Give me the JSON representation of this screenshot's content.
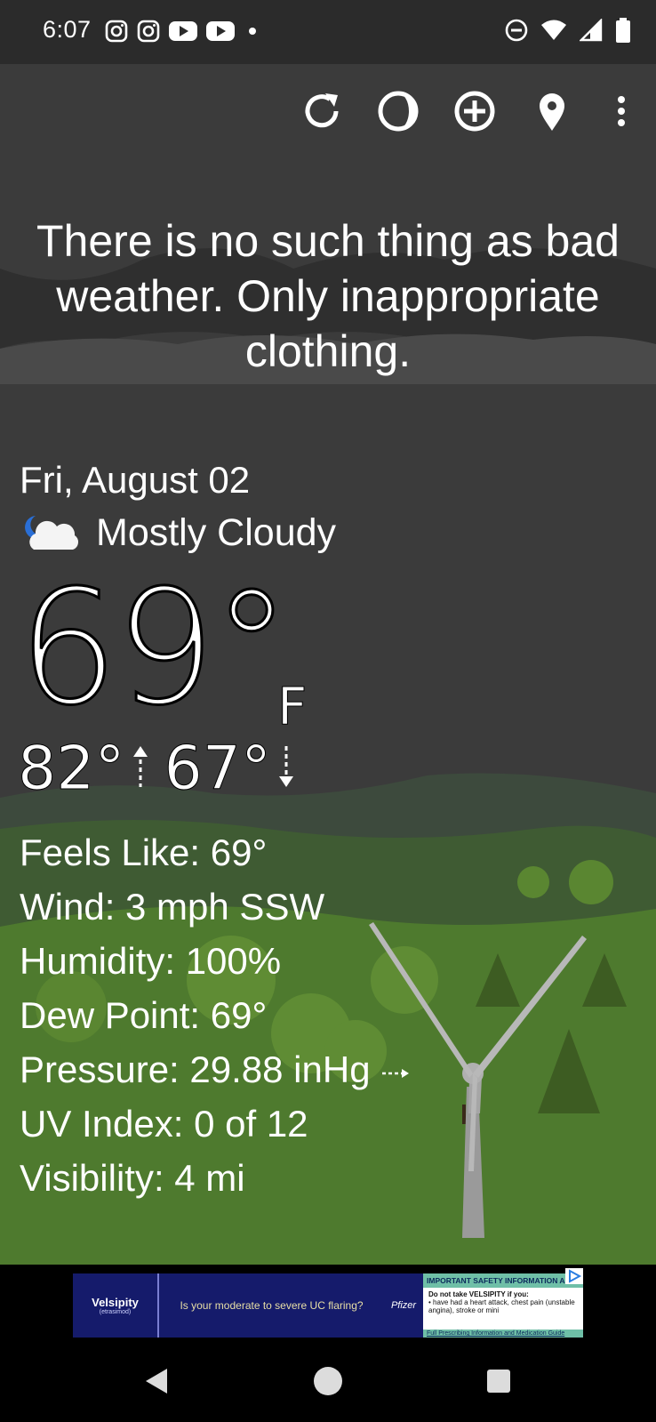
{
  "status_bar": {
    "time": "6:07",
    "left_icons": [
      "instagram-icon",
      "instagram-icon",
      "youtube-icon",
      "youtube-icon",
      "dot-icon"
    ],
    "right_icons": [
      "do-not-disturb-icon",
      "wifi-icon",
      "signal-icon",
      "battery-icon"
    ]
  },
  "toolbar": {
    "icons": [
      "refresh-icon",
      "moon-phase-icon",
      "add-location-icon",
      "location-pin-icon",
      "more-vert-icon"
    ]
  },
  "quote": "There is no such thing as bad weather. Only inappropriate clothing.",
  "weather": {
    "date": "Fri, August 02",
    "condition": "Mostly Cloudy",
    "condition_icon": "partly-cloudy-night-icon",
    "temperature": "69°",
    "unit": "F",
    "high": "82°",
    "low": "67°",
    "details": [
      "Feels Like:  69°",
      "Wind:  3 mph SSW",
      "Humidity:  100%",
      "Dew Point:  69°",
      "Pressure:  29.88 inHg",
      "UV Index:  0 of 12",
      "Visibility:  4 mi"
    ],
    "pressure_trend_icon": "steady-arrow-icon"
  },
  "ad": {
    "brand": "Velsipity",
    "brand_sub": "(etrasimod)",
    "headline": "Is your moderate to severe UC flaring?",
    "company": "Pfizer",
    "safety_header": "IMPORTANT SAFETY INFORMATION AN",
    "safety_line1": "Do not take VELSIPITY if you:",
    "safety_line2": "• have had a heart attack, chest pain (unstable angina), stroke or mini",
    "safety_footer": "Full Prescribing Information and Medication Guide"
  },
  "nav_bar": {
    "icons": [
      "back-icon",
      "home-icon",
      "recents-icon"
    ]
  },
  "colors": {
    "status_bar_bg": "#2b2b2b",
    "sky": "#3b3b3b",
    "hills_green": "#4f7a30",
    "ad_bg": "#151b6b"
  }
}
